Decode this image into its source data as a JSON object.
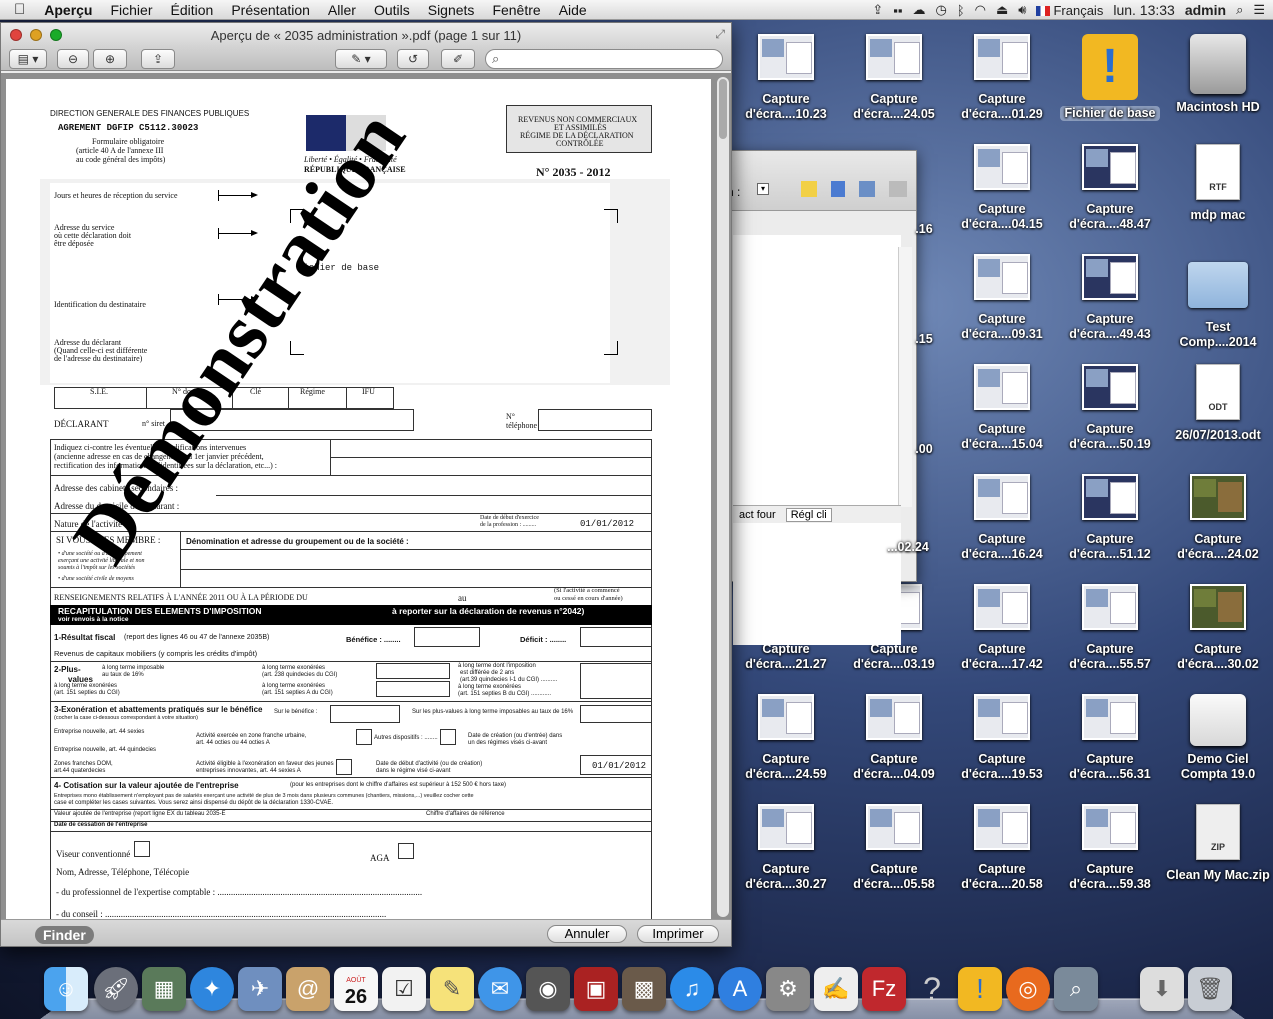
{
  "menubar": {
    "apple": "",
    "app": "Aperçu",
    "items": [
      "Fichier",
      "Édition",
      "Présentation",
      "Aller",
      "Outils",
      "Signets",
      "Fenêtre",
      "Aide"
    ],
    "input_source": "Français",
    "clock": "lun. 13:33",
    "user": "admin"
  },
  "window": {
    "title": "Aperçu de « 2035 administration ».pdf (page 1 sur 11)",
    "search_placeholder": "",
    "finder_badge": "Finder",
    "cancel_label": "Annuler",
    "print_label": "Imprimer"
  },
  "pdf": {
    "dir": "DIRECTION GENERALE DES FINANCES PUBLIQUES",
    "agrement": "AGREMENT DGFIP C5112.30023",
    "form1": "Formulaire obligatoire",
    "form2": "(article 40 A de l'annexe III",
    "form3": "au code général des impôts)",
    "motto": "Liberté • Égalité • Fraternité",
    "republic": "RÉPUBLIQUE FRANÇAISE",
    "regime1": "REVENUS NON COMMERCIAUX",
    "regime2": "ET ASSIMILÉS",
    "regime3": "RÉGIME DE LA DÉCLARATION",
    "regime4": "CONTRÔLÉE",
    "number": "N° 2035   - 2012",
    "l_jours": "Jours et heures de réception du service",
    "l_adresse1": "Adresse du service",
    "l_adresse2": "où cette déclaration doit",
    "l_adresse3": "être déposée",
    "l_fichier": "fichier de base",
    "l_ident": "Identification du destinataire",
    "l_decl1": "Adresse du déclarant",
    "l_decl2": "(Quand celle-ci est différente",
    "l_decl3": "de l'adresse du destinataire)",
    "cols": [
      "S.I.E.",
      "N° dossier",
      "Clé",
      "Régime",
      "IFU"
    ],
    "declarant": "DÉCLARANT",
    "siret": "n° siret",
    "tel": "N° téléphone",
    "modif1": "Indiquez ci-contre les éventuelles modifications intervenues",
    "modif2": "(ancienne adresse en cas de changement au 1er janvier précédent,",
    "modif3": "rectification des informations préidentifiées sur la déclaration, etc...) :",
    "cabinets": "Adresse des cabinets secondaires :",
    "domicile": "Adresse du domicile du déclarant :",
    "nature": "Nature de l'activité :",
    "debut1": "Date de début d'exercice",
    "debut2": "de la profession : .........",
    "date1": "01/01/2012",
    "membre": "SI VOUS ÊTES MEMBRE :",
    "denomination": "Dénomination et adresse du groupement ou de la société :",
    "membre_a": "• d'une société ou d'un groupement",
    "membre_b": "exerçant une activité libérale et non",
    "membre_c": "soumis à l'impôt sur les sociétés",
    "membre_d": "• d'une société civile de moyens",
    "renseign": "RENSEIGNEMENTS RELATIFS À L'ANNÉE 2011 OU À LA PÉRIODE DU",
    "au": "au",
    "si_activite1": "(Si l'activité a commencé",
    "si_activite2": "ou cessé en cours d'année)",
    "recap": "RECAPITULATION DES ELEMENTS D'IMPOSITION",
    "recap_right": "à reporter sur la déclaration de revenus n°2042)",
    "voir": "voir renvois à la notice",
    "res_fiscal": "1-Résultat fiscal",
    "res_fiscal_sub": "(report des lignes 46 ou 47 de l'annexe 2035B)",
    "benefice": "Bénéfice : ........",
    "deficit": "Déficit : ........",
    "capitaux": "Revenus de capitaux mobiliers (y compris les crédits d'impôt)",
    "plus_values": "2-Plus-",
    "values": "values",
    "pv1": "à long terme imposable",
    "pv2": "au taux de 16%",
    "pv3": "à long terme exonérées",
    "pv4": "(art. 151 septies du CGI)",
    "pv5": "à long terme dont l'imposition",
    "pv6": "est différée de 2 ans",
    "pv7": "(art.39 quindecies I-1 du CGI) ..........",
    "pv8": "à long terme exonérées",
    "pv9": "(art. 151 septies B du CGI) ............",
    "pv10": "à long terme exonérées",
    "pv11": "(art. 238 quindecies du CGI)",
    "pv12": "à long terme exonérées",
    "pv13": "(art. 151 septies A du CGI)",
    "exon": "3-Exonération et abattements pratiqués sur le bénéfice",
    "exon_sub": "(cocher la case ci-dessous correspondant à votre situation)",
    "sur_benef": "Sur le bénéfice :",
    "sur_pv": "Sur les plus-values à long terme imposables au taux de 16%",
    "entr1": "Entreprise nouvelle, art. 44 sexies",
    "entr2": "Entreprise nouvelle, art. 44 quindecies",
    "urbaine": "Activité exercée en zone franche urbaine,",
    "urbaine2": "art. 44 octies ou 44 octies A",
    "autres": "Autres dispositifs : ........",
    "creation1": "Date de création (ou d'entrée) dans",
    "creation2": "un des régimes visés ci-avant",
    "zones1": "Zones franches DOM,",
    "zones2": "art.44 quaterdecies",
    "jeunes1": "Activité éligible à l'exonération en faveur des jeunes",
    "jeunes2": "entreprises innovantes, art. 44 sexies A",
    "debut_act1": "Date de début d'activité (ou de création)",
    "debut_act2": "dans le régime visé ci-avant",
    "date2": "01/01/2012",
    "cotisation": "4- Cotisation sur la valeur ajoutée de l'entreprise",
    "cotisation_sub": "(pour les entreprises dont le chiffre d'affaires est supérieur à 152 500 €  hors taxe)",
    "cot1": "Entreprises mono établissement n'employant pas de salariés exerçant une activité de plus de 3 mois dans plusieurs communes (chantiers, missions,...) veuillez cocher cette",
    "cot2": "case et compléter les cases suivantes.  Vous serez ainsi dispensé du dépôt de la déclaration 1330-CVAE.",
    "valeur": "Valeur ajoutée de l'entreprise (report ligne EX du tableau 2035-E",
    "chiffre": "Chiffre d'affaires de référence",
    "cessation": "Date de cessation de l'entreprise",
    "viseur": "Viseur conventionné",
    "aga": "AGA",
    "nom": "Nom, Adresse, Téléphone, Télécopie",
    "prof": "- du professionnel de l'expertise comptable : ...........................................................................................",
    "conseil": "- du conseil : .............................................................................................................................",
    "watermark": "Démonstration"
  },
  "bgwin": {
    "col1": "act four",
    "col2": "Régl cli",
    "frag_n": "n :"
  },
  "desktop": {
    "icons": [
      {
        "label": "Capture d'écra....10.23",
        "kind": "thumb"
      },
      {
        "label": "Capture d'écra....24.05",
        "kind": "thumb"
      },
      {
        "label": "Capture d'écra....01.29",
        "kind": "thumb"
      },
      {
        "label": "Fichier de base",
        "kind": "app"
      },
      {
        "label": "Macintosh HD",
        "kind": "drive"
      },
      {
        "label": ".16",
        "kind": "frag"
      },
      {
        "label": "Capture d'écra....04.15",
        "kind": "thumb"
      },
      {
        "label": "Capture d'écra....48.47",
        "kind": "dark"
      },
      {
        "label": "mdp mac",
        "kind": "rtf"
      },
      {
        "label": ".15",
        "kind": "frag"
      },
      {
        "label": "Capture d'écra....09.31",
        "kind": "thumb"
      },
      {
        "label": "Capture d'écra....49.43",
        "kind": "dark"
      },
      {
        "label": "Test Comp....2014",
        "kind": "folder"
      },
      {
        "label": ".00",
        "kind": "frag"
      },
      {
        "label": "Capture d'écra....15.04",
        "kind": "thumb"
      },
      {
        "label": "Capture d'écra....50.19",
        "kind": "dark"
      },
      {
        "label": "26/07/2013.odt",
        "kind": "odt"
      },
      {
        "label": "...02.24",
        "kind": "frag"
      },
      {
        "label": "Capture d'écra....16.24",
        "kind": "thumb"
      },
      {
        "label": "Capture d'écra....51.12",
        "kind": "dark"
      },
      {
        "label": "Capture d'écra....24.02",
        "kind": "game"
      },
      {
        "label": "Capture d'écra....21.27",
        "kind": "thumb"
      },
      {
        "label": "Capture d'écra....03.19",
        "kind": "thumb"
      },
      {
        "label": "Capture d'écra....17.42",
        "kind": "thumb"
      },
      {
        "label": "Capture d'écra....55.57",
        "kind": "thumb"
      },
      {
        "label": "Capture d'écra....30.02",
        "kind": "game"
      },
      {
        "label": "Capture d'écra....24.59",
        "kind": "thumb"
      },
      {
        "label": "Capture d'écra....04.09",
        "kind": "thumb"
      },
      {
        "label": "Capture d'écra....19.53",
        "kind": "thumb"
      },
      {
        "label": "Capture d'écra....56.31",
        "kind": "thumb"
      },
      {
        "label": "Demo Ciel Compta 19.0",
        "kind": "drive2"
      },
      {
        "label": "Capture d'écra....30.27",
        "kind": "thumb"
      },
      {
        "label": "Capture d'écra....05.58",
        "kind": "thumb"
      },
      {
        "label": "Capture d'écra....20.58",
        "kind": "thumb"
      },
      {
        "label": "Capture d'écra....59.38",
        "kind": "thumb"
      },
      {
        "label": "Clean My Mac.zip",
        "kind": "zip"
      }
    ]
  },
  "dock": {
    "calendar_day": "26",
    "calendar_month": "AOÛT"
  },
  "colors": {
    "accent": "#1aab29"
  }
}
